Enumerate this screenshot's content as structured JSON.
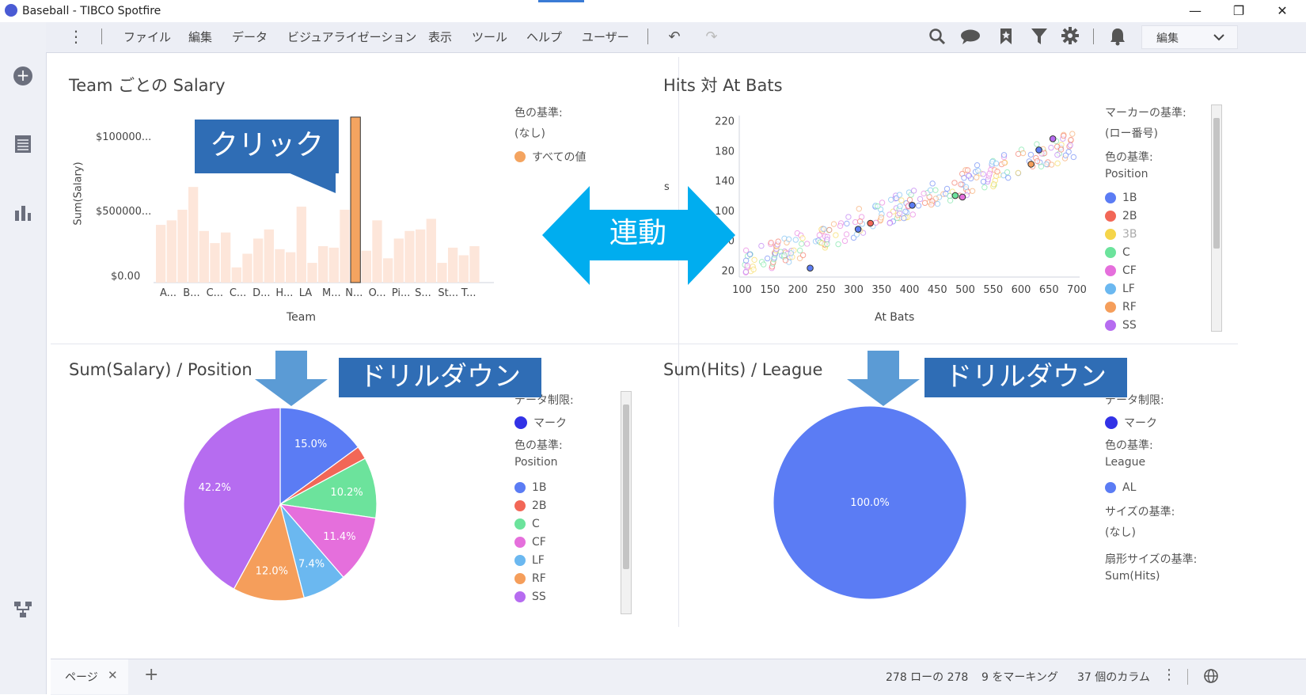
{
  "window": {
    "title": "Baseball - TIBCO Spotfire",
    "min_glyph": "—",
    "max_glyph": "❐",
    "close_glyph": "✕"
  },
  "menu": {
    "items": [
      "ファイル",
      "編集",
      "データ",
      "ビジュアライゼーション",
      "表示",
      "ツール",
      "ヘルプ",
      "ユーザー"
    ],
    "mode_select": "編集"
  },
  "icons": {
    "left": [
      "add-icon",
      "data-table-icon",
      "bar-chart-icon",
      "flow-icon"
    ],
    "toolbar": [
      "more-icon",
      "undo-icon",
      "redo-icon",
      "search-icon",
      "comment-icon",
      "bookmark-icon",
      "filter-icon",
      "settings-icon",
      "notification-icon",
      "chevron-down-icon"
    ]
  },
  "bar_panel": {
    "title": "Team ごとの Salary",
    "ylabel": "Sum(Salary)",
    "xlabel": "Team",
    "color_by_label": "色の基準:",
    "color_by_value": "(なし)",
    "legend_item": "すべての値",
    "legend_color": "#f4a460"
  },
  "scatter_panel": {
    "title": "Hits 対 At Bats",
    "xlabel": "At Bats",
    "ylabel_fragment": "s",
    "marker_label": "マーカーの基準:",
    "marker_value": "(ロー番号)",
    "color_by_label": "色の基準:",
    "color_by_value": "Position",
    "legend": [
      {
        "name": "1B",
        "color": "#5b7cf4"
      },
      {
        "name": "2B",
        "color": "#f26757"
      },
      {
        "name": "3B",
        "color": "#f5d54a"
      },
      {
        "name": "C",
        "color": "#6ce39c"
      },
      {
        "name": "CF",
        "color": "#e56fdc"
      },
      {
        "name": "LF",
        "color": "#6bb8f0"
      },
      {
        "name": "RF",
        "color": "#f59e5b"
      },
      {
        "name": "SS",
        "color": "#b66cf0"
      }
    ]
  },
  "pie_position": {
    "title": "Sum(Salary) / Position",
    "data_limit_label": "データ制限:",
    "data_limit_value": "マーク",
    "color_by_label": "色の基準:",
    "color_by_value": "Position",
    "legend": [
      {
        "name": "1B",
        "color": "#5b7cf4"
      },
      {
        "name": "2B",
        "color": "#f26757"
      },
      {
        "name": "C",
        "color": "#6ce39c"
      },
      {
        "name": "CF",
        "color": "#e56fdc"
      },
      {
        "name": "LF",
        "color": "#6bb8f0"
      },
      {
        "name": "RF",
        "color": "#f59e5b"
      },
      {
        "name": "SS",
        "color": "#b66cf0"
      }
    ]
  },
  "pie_league": {
    "title": "Sum(Hits) / League",
    "data_limit_label": "データ制限:",
    "data_limit_value": "マーク",
    "color_by_label": "色の基準:",
    "color_by_value": "League",
    "legend": [
      {
        "name": "AL",
        "color": "#5b7cf4"
      }
    ],
    "size_by_label": "サイズの基準:",
    "size_by_value": "(なし)",
    "sector_by_label": "扇形サイズの基準:",
    "sector_by_value": "Sum(Hits)"
  },
  "annotations": {
    "click": "クリック",
    "link": "連動",
    "drill1": "ドリルダウン",
    "drill2": "ドリルダウン"
  },
  "status": {
    "page_tab": "ページ",
    "rows": "278 ローの 278",
    "marked": "9 をマーキング",
    "columns": "37 個のカラム"
  },
  "chart_data": [
    {
      "type": "bar",
      "ylabel": "Sum(Salary)",
      "xlabel": "Team",
      "y_ticks": [
        "$0.00",
        "$500000...",
        "$100000..."
      ],
      "tick_labels": [
        "A...",
        "B...",
        "C...",
        "C...",
        "D...",
        "H...",
        "LA",
        "M...",
        "N...",
        "O...",
        "Pi...",
        "S...",
        "St...",
        "T..."
      ],
      "values": [
        0.38,
        0.41,
        0.48,
        0.63,
        0.34,
        0.26,
        0.33,
        0.1,
        0.19,
        0.29,
        0.35,
        0.22,
        0.2,
        0.5,
        0.13,
        0.24,
        0.23,
        0.48,
        1.09,
        0.21,
        0.41,
        0.16,
        0.29,
        0.34,
        0.35,
        0.42,
        0.13,
        0.23,
        0.18,
        0.24
      ],
      "highlight_index": 18,
      "ylim": [
        0,
        1.1
      ]
    },
    {
      "type": "scatter",
      "xlabel": "At Bats",
      "x_ticks": [
        100,
        150,
        200,
        250,
        300,
        350,
        400,
        450,
        500,
        550,
        600,
        650,
        700
      ],
      "y_ticks": [
        20,
        60,
        100,
        140,
        180,
        220
      ],
      "xlim": [
        95,
        705
      ],
      "ylim": [
        12,
        228
      ]
    },
    {
      "type": "pie",
      "labels": [
        "1B",
        "2B",
        "C",
        "CF",
        "LF",
        "RF",
        "SS"
      ],
      "values": [
        15.0,
        2.2,
        10.2,
        11.4,
        7.4,
        12.0,
        42.2
      ],
      "value_labels": [
        "15.0%",
        "",
        "10.2%",
        "11.4%",
        "7.4%",
        "12.0%",
        "42.2%"
      ]
    },
    {
      "type": "pie",
      "labels": [
        "AL"
      ],
      "values": [
        100.0
      ],
      "value_labels": [
        "100.0%"
      ]
    }
  ]
}
